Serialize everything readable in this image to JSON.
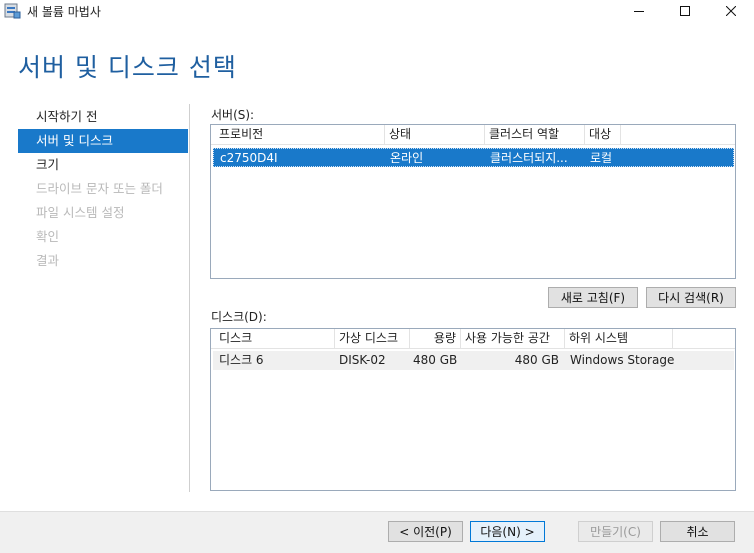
{
  "window": {
    "title": "새 볼륨 마법사",
    "minimize_icon": "minimize-icon",
    "maximize_icon": "maximize-icon",
    "close_icon": "close-icon"
  },
  "page": {
    "heading": "서버 및 디스크 선택"
  },
  "nav": {
    "items": [
      {
        "label": "시작하기 전",
        "state": "normal"
      },
      {
        "label": "서버 및 디스크",
        "state": "active"
      },
      {
        "label": "크기",
        "state": "normal"
      },
      {
        "label": "드라이브 문자 또는 폴더",
        "state": "disabled"
      },
      {
        "label": "파일 시스템 설정",
        "state": "disabled"
      },
      {
        "label": "확인",
        "state": "disabled"
      },
      {
        "label": "결과",
        "state": "disabled"
      }
    ]
  },
  "servers": {
    "label": "서버(S):",
    "columns": [
      "프로비전",
      "상태",
      "클러스터 역할",
      "대상"
    ],
    "rows": [
      {
        "provision": "c2750D4I",
        "status": "온라인",
        "cluster_role": "클러스터되지...",
        "target": "로컬",
        "selected": true
      }
    ]
  },
  "buttons": {
    "refresh": "새로 고침(F)",
    "rescan": "다시 검색(R)",
    "previous": "< 이전(P)",
    "next": "다음(N) >",
    "create": "만들기(C)",
    "cancel": "취소"
  },
  "disks": {
    "label": "디스크(D):",
    "columns": [
      "디스크",
      "가상 디스크",
      "용량",
      "사용 가능한 공간",
      "하위 시스템"
    ],
    "rows": [
      {
        "disk": "디스크 6",
        "virtual_disk": "DISK-02",
        "capacity": "480 GB",
        "free_space": "480 GB",
        "subsystem": "Windows Storage"
      }
    ]
  },
  "colors": {
    "accent": "#1979ca",
    "heading": "#1f5fa0"
  }
}
